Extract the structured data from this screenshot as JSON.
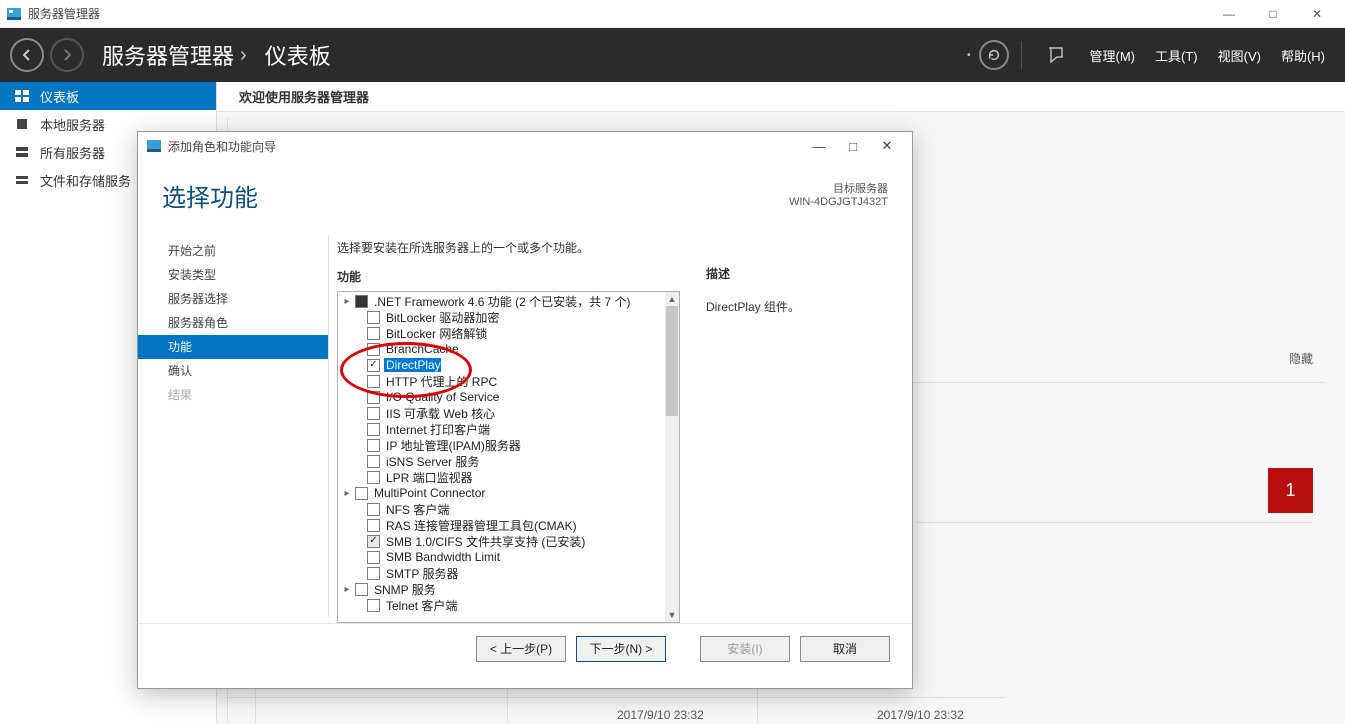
{
  "mainwindow": {
    "title": "服务器管理器",
    "crumb1": "服务器管理器",
    "crumb2": "仪表板",
    "menu": {
      "manage": "管理(M)",
      "tools": "工具(T)",
      "view": "视图(V)",
      "help": "帮助(H)"
    },
    "refresh_dropdown_prefix": "•"
  },
  "sidebar": {
    "items": [
      {
        "label": "仪表板"
      },
      {
        "label": "本地服务器"
      },
      {
        "label": "所有服务器"
      },
      {
        "label": "文件和存储服务"
      }
    ]
  },
  "welcome": {
    "title": "欢迎使用服务器管理器"
  },
  "bg": {
    "hide": "隐藏",
    "redbox": "1",
    "ts1": "2017/9/10 23:32",
    "ts2": "2017/9/10 23:32"
  },
  "wizard": {
    "title": "添加角色和功能向导",
    "heading": "选择功能",
    "target_label": "目标服务器",
    "target_name": "WIN-4DGJGTJ432T",
    "nav": {
      "before": "开始之前",
      "install_type": "安装类型",
      "server_select": "服务器选择",
      "server_roles": "服务器角色",
      "features": "功能",
      "confirm": "确认",
      "results": "结果"
    },
    "intro": "选择要安装在所选服务器上的一个或多个功能。",
    "list_label": "功能",
    "desc_label": "描述",
    "desc_text": "DirectPlay 组件。",
    "features": [
      {
        "label": ".NET Framework 4.6 功能 (2 个已安装，共 7 个)",
        "state": "partial",
        "exp": "▸",
        "indent": 0
      },
      {
        "label": "BitLocker 驱动器加密",
        "state": "none",
        "indent": 1
      },
      {
        "label": "BitLocker 网络解锁",
        "state": "none",
        "indent": 1
      },
      {
        "label": "BranchCache",
        "state": "none",
        "indent": 1
      },
      {
        "label": "DirectPlay",
        "state": "checked",
        "highlight": true,
        "indent": 1
      },
      {
        "label": "HTTP 代理上的 RPC",
        "state": "none",
        "indent": 1
      },
      {
        "label": "I/O Quality of Service",
        "state": "none",
        "indent": 1
      },
      {
        "label": "IIS 可承载 Web 核心",
        "state": "none",
        "indent": 1
      },
      {
        "label": "Internet 打印客户端",
        "state": "none",
        "indent": 1
      },
      {
        "label": "IP 地址管理(IPAM)服务器",
        "state": "none",
        "indent": 1
      },
      {
        "label": "iSNS Server 服务",
        "state": "none",
        "indent": 1
      },
      {
        "label": "LPR 端口监视器",
        "state": "none",
        "indent": 1
      },
      {
        "label": "MultiPoint Connector",
        "state": "none",
        "exp": "▸",
        "indent": 0
      },
      {
        "label": "NFS 客户端",
        "state": "none",
        "indent": 1
      },
      {
        "label": "RAS 连接管理器管理工具包(CMAK)",
        "state": "none",
        "indent": 1
      },
      {
        "label": "SMB 1.0/CIFS 文件共享支持 (已安装)",
        "state": "installed",
        "indent": 1
      },
      {
        "label": "SMB Bandwidth Limit",
        "state": "none",
        "indent": 1
      },
      {
        "label": "SMTP 服务器",
        "state": "none",
        "indent": 1
      },
      {
        "label": "SNMP 服务",
        "state": "none",
        "exp": "▸",
        "indent": 0
      },
      {
        "label": "Telnet 客户端",
        "state": "none",
        "indent": 1
      }
    ],
    "buttons": {
      "prev": "< 上一步(P)",
      "next": "下一步(N) >",
      "install": "安装(I)",
      "cancel": "取消"
    }
  }
}
